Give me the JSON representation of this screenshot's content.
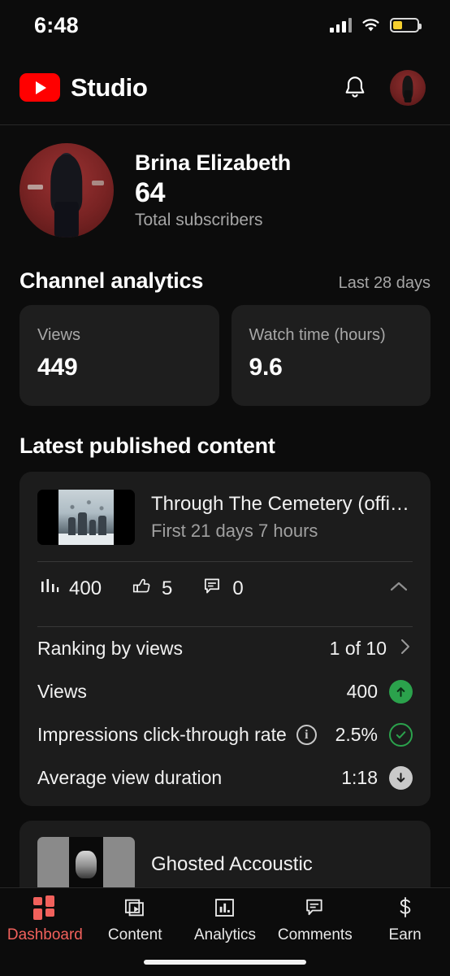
{
  "status_bar": {
    "time": "6:48",
    "signal_icon": "cellular-signal-icon",
    "wifi_icon": "wifi-icon",
    "battery_icon": "battery-icon",
    "battery_level_percent": 38,
    "battery_color": "#f5cf2e"
  },
  "app_bar": {
    "logo_icon": "youtube-logo-icon",
    "title": "Studio",
    "notifications_icon": "bell-icon",
    "avatar_icon": "account-avatar"
  },
  "channel": {
    "avatar_icon": "channel-avatar",
    "name": "Brina Elizabeth",
    "subscriber_count": "64",
    "subscriber_label": "Total subscribers"
  },
  "analytics": {
    "title": "Channel analytics",
    "period": "Last 28 days",
    "cards": [
      {
        "label": "Views",
        "value": "449"
      },
      {
        "label": "Watch time (hours)",
        "value": "9.6"
      }
    ]
  },
  "latest_content": {
    "title": "Latest published content",
    "primary_video": {
      "thumbnail_icon": "video-thumbnail",
      "title": "Through The Cemetery (official...",
      "subtitle": "First 21 days 7 hours",
      "engagement": [
        {
          "icon": "bar-chart-icon",
          "value": "400"
        },
        {
          "icon": "thumbs-up-icon",
          "value": "5"
        },
        {
          "icon": "comment-icon",
          "value": "0"
        }
      ],
      "collapse_icon": "chevron-up-icon",
      "metrics": [
        {
          "label": "Ranking by views",
          "value": "1 of 10",
          "indicator": "chevron-right-icon"
        },
        {
          "label": "Views",
          "value": "400",
          "indicator": "arrow-up-badge"
        },
        {
          "label": "Impressions click-through rate",
          "value": "2.5%",
          "indicator": "check-badge",
          "info_icon": "info-icon"
        },
        {
          "label": "Average view duration",
          "value": "1:18",
          "indicator": "arrow-down-badge"
        }
      ]
    },
    "secondary_video": {
      "thumbnail_icon": "video-thumbnail",
      "title": "Ghosted Accoustic"
    }
  },
  "bottom_nav": {
    "active_color": "#f1615c",
    "items": [
      {
        "label": "Dashboard",
        "icon": "grid-dashboard-icon",
        "active": true
      },
      {
        "label": "Content",
        "icon": "video-stack-icon",
        "active": false
      },
      {
        "label": "Analytics",
        "icon": "bar-chart-icon",
        "active": false
      },
      {
        "label": "Comments",
        "icon": "comment-icon",
        "active": false
      },
      {
        "label": "Earn",
        "icon": "dollar-icon",
        "active": false
      }
    ]
  }
}
